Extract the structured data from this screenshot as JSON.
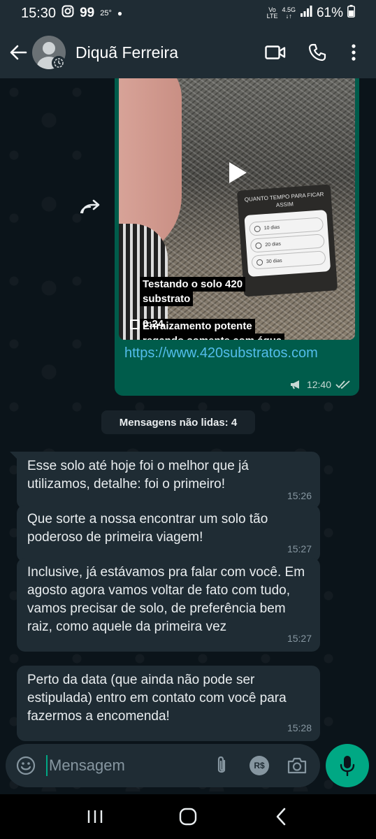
{
  "status_bar": {
    "time": "15:30",
    "notif_count": "99",
    "temperature": "25°",
    "carrier_top": "Vo",
    "carrier_bottom": "LTE",
    "network": "4.5G",
    "battery": "61%"
  },
  "header": {
    "contact_name": "Diquã Ferreira"
  },
  "outgoing_message": {
    "video_caption_line1": "Testando o solo 420",
    "video_caption_line2": "substrato",
    "video_caption_line3": "Enraizamento potente",
    "video_caption_line4": "regando somente com água",
    "poll_title": "QUANTO TEMPO PARA FICAR ASSIM",
    "poll_options": [
      "10 dias",
      "20 dias",
      "30 dias"
    ],
    "duration": "0:24",
    "link": "https://www.420substratos.com",
    "time": "12:40"
  },
  "unread_divider": "Mensagens não lidas: 4",
  "incoming_messages": [
    {
      "text": "Esse solo até hoje foi o melhor que já utilizamos, detalhe: foi o primeiro!",
      "time": "15:26"
    },
    {
      "text": "Que sorte a nossa encontrar um solo tão poderoso de primeira viagem!",
      "time": "15:27"
    },
    {
      "text": "Inclusive, já estávamos pra falar com você. Em agosto agora vamos voltar de fato com tudo, vamos precisar de solo, de preferência bem raiz, como aquele da primeira vez",
      "time": "15:27"
    },
    {
      "text": "Perto da data (que ainda não pode ser estipulada) entro em contato com você para fazermos a encomenda!",
      "time": "15:28"
    }
  ],
  "composer": {
    "placeholder": "Mensagem",
    "payment_label": "R$"
  },
  "colors": {
    "accent": "#00a884",
    "outgoing_bubble": "#005c4b",
    "incoming_bubble": "#1f2c34",
    "link": "#53bdeb"
  }
}
